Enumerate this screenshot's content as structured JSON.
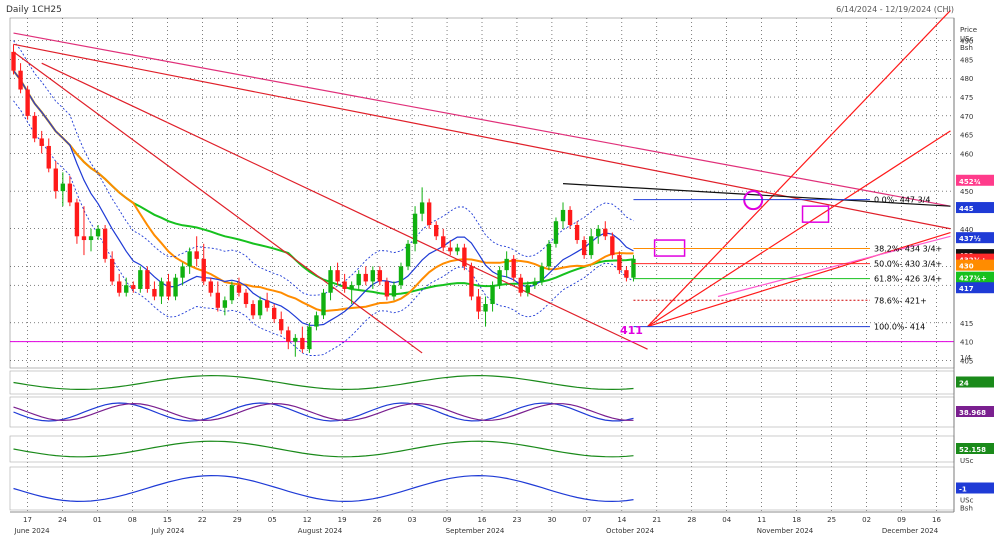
{
  "header": {
    "title": "Daily 1CH25",
    "date_range": "6/14/2024 - 12/19/2024 (CHI)"
  },
  "price_axis": {
    "label_lines": [
      "Price",
      "USc",
      "Bsh"
    ],
    "ticks": [
      "490",
      "485",
      "480",
      "475",
      "470",
      "465",
      "460",
      "450",
      "440",
      "430",
      "425",
      "415",
      "410",
      "405"
    ],
    "extra_label": "1/4",
    "badges": [
      {
        "text": "452¾",
        "value": 452.75,
        "color": "#ff3b8b",
        "text_color": "#ffffff"
      },
      {
        "text": "445",
        "value": 445.5,
        "color": "#1f3bd6",
        "text_color": "#ffffff"
      },
      {
        "text": "437½",
        "value": 437.5,
        "color": "#1f3bd6",
        "text_color": "#ffffff"
      },
      {
        "text": "433",
        "value": 433.0,
        "color": "#111111",
        "text_color": "#ffffff"
      },
      {
        "text": "432¾+",
        "value": 431.8,
        "color": "#ff2a2a",
        "text_color": "#ffffff"
      },
      {
        "text": "430",
        "value": 430.2,
        "color": "#ff8c00",
        "text_color": "#ffffff"
      },
      {
        "text": "427¾+",
        "value": 427.0,
        "color": "#16c11e",
        "text_color": "#ffffff"
      },
      {
        "text": "417",
        "value": 424.2,
        "color": "#1f3bd6",
        "text_color": "#ffffff"
      }
    ]
  },
  "fib_labels": [
    {
      "text": "0.0%- 447 3/4",
      "value": 447.75,
      "color": "#1f3bd6"
    },
    {
      "text": "38.2%- 434 3/4+",
      "value": 434.75,
      "color": "#ff8c00"
    },
    {
      "text": "50.0%- 430 3/4+",
      "value": 430.75,
      "color": "#ff2a2a"
    },
    {
      "text": "61.8%- 426 3/4+",
      "value": 426.75,
      "color": "#16c11e"
    },
    {
      "text": "78.6%- 421+",
      "value": 421.0,
      "color": "#d00000"
    },
    {
      "text": "100.0%- 414",
      "value": 414.0,
      "color": "#1f3bd6"
    }
  ],
  "annotation_low": {
    "text": "411",
    "color": "#e000e0"
  },
  "indicator_panels": [
    {
      "name": "momentum",
      "value_badge": "24",
      "badge_color": "#1a8a1a",
      "units": []
    },
    {
      "name": "stochastic",
      "value_badge": "38.968",
      "badge_color": "#7a1f8f",
      "units": []
    },
    {
      "name": "rsi",
      "value_badge": "52.158",
      "badge_color": "#1a8a1a",
      "units": [
        "USc"
      ]
    },
    {
      "name": "macd",
      "value_badge": "-1",
      "badge_color": "#1f3bd6",
      "units": [
        "USc",
        "Bsh"
      ]
    }
  ],
  "x_axis": {
    "day_ticks": [
      "17",
      "24",
      "01",
      "08",
      "15",
      "22",
      "29",
      "05",
      "12",
      "19",
      "26",
      "03",
      "09",
      "16",
      "23",
      "30",
      "07",
      "14",
      "21",
      "28",
      "04",
      "11",
      "18",
      "25",
      "02",
      "09",
      "16"
    ],
    "months": [
      "June 2024",
      "July 2024",
      "August 2024",
      "September 2024",
      "October 2024",
      "November 2024",
      "December 2024"
    ]
  },
  "colors": {
    "up_candle": "#10b010",
    "down_candle": "#ff1a1a",
    "background": "#ffffff",
    "grid": "#000000"
  },
  "chart_data": {
    "type": "candlestick",
    "title": "Daily 1CH25",
    "subtitle": "6/14/2024 - 12/19/2024 (CHI)",
    "y_units": "USc/Bsh",
    "ylim": [
      403,
      496
    ],
    "grid": true,
    "ohlc": [
      {
        "o": 487,
        "h": 489,
        "l": 481,
        "c": 482
      },
      {
        "o": 482,
        "h": 484,
        "l": 476,
        "c": 477
      },
      {
        "o": 477,
        "h": 478,
        "l": 469,
        "c": 470
      },
      {
        "o": 470,
        "h": 471,
        "l": 463,
        "c": 464
      },
      {
        "o": 464,
        "h": 466,
        "l": 460,
        "c": 462
      },
      {
        "o": 462,
        "h": 464,
        "l": 455,
        "c": 456
      },
      {
        "o": 456,
        "h": 458,
        "l": 448,
        "c": 450
      },
      {
        "o": 450,
        "h": 455,
        "l": 446,
        "c": 452
      },
      {
        "o": 452,
        "h": 454,
        "l": 446,
        "c": 447
      },
      {
        "o": 447,
        "h": 448,
        "l": 436,
        "c": 438
      },
      {
        "o": 438,
        "h": 446,
        "l": 433,
        "c": 437
      },
      {
        "o": 437,
        "h": 440,
        "l": 434,
        "c": 438
      },
      {
        "o": 438,
        "h": 441,
        "l": 437,
        "c": 440
      },
      {
        "o": 440,
        "h": 441,
        "l": 431,
        "c": 432
      },
      {
        "o": 432,
        "h": 434,
        "l": 425,
        "c": 426
      },
      {
        "o": 426,
        "h": 428,
        "l": 422,
        "c": 423
      },
      {
        "o": 423,
        "h": 427,
        "l": 422,
        "c": 425
      },
      {
        "o": 425,
        "h": 426,
        "l": 423,
        "c": 424
      },
      {
        "o": 424,
        "h": 430,
        "l": 423,
        "c": 429
      },
      {
        "o": 429,
        "h": 430,
        "l": 423,
        "c": 424
      },
      {
        "o": 424,
        "h": 426,
        "l": 421,
        "c": 422
      },
      {
        "o": 422,
        "h": 427,
        "l": 420,
        "c": 426
      },
      {
        "o": 426,
        "h": 428,
        "l": 421,
        "c": 422
      },
      {
        "o": 422,
        "h": 428,
        "l": 421,
        "c": 427
      },
      {
        "o": 427,
        "h": 431,
        "l": 425,
        "c": 430
      },
      {
        "o": 430,
        "h": 435,
        "l": 428,
        "c": 434
      },
      {
        "o": 434,
        "h": 438,
        "l": 430,
        "c": 432
      },
      {
        "o": 432,
        "h": 436,
        "l": 425,
        "c": 426
      },
      {
        "o": 426,
        "h": 427,
        "l": 422,
        "c": 423
      },
      {
        "o": 423,
        "h": 426,
        "l": 418,
        "c": 419
      },
      {
        "o": 419,
        "h": 422,
        "l": 417,
        "c": 421
      },
      {
        "o": 421,
        "h": 426,
        "l": 420,
        "c": 425
      },
      {
        "o": 425,
        "h": 427,
        "l": 422,
        "c": 423
      },
      {
        "o": 423,
        "h": 424,
        "l": 419,
        "c": 420
      },
      {
        "o": 420,
        "h": 421,
        "l": 416,
        "c": 417
      },
      {
        "o": 417,
        "h": 422,
        "l": 416,
        "c": 421
      },
      {
        "o": 421,
        "h": 423,
        "l": 418,
        "c": 419
      },
      {
        "o": 419,
        "h": 420,
        "l": 415,
        "c": 416
      },
      {
        "o": 416,
        "h": 418,
        "l": 412,
        "c": 413
      },
      {
        "o": 413,
        "h": 414,
        "l": 408,
        "c": 410
      },
      {
        "o": 410,
        "h": 412,
        "l": 406,
        "c": 411
      },
      {
        "o": 411,
        "h": 414,
        "l": 407,
        "c": 408
      },
      {
        "o": 408,
        "h": 415,
        "l": 407,
        "c": 414
      },
      {
        "o": 414,
        "h": 418,
        "l": 413,
        "c": 417
      },
      {
        "o": 417,
        "h": 424,
        "l": 416,
        "c": 423
      },
      {
        "o": 423,
        "h": 430,
        "l": 421,
        "c": 429
      },
      {
        "o": 429,
        "h": 431,
        "l": 425,
        "c": 426
      },
      {
        "o": 426,
        "h": 428,
        "l": 423,
        "c": 424
      },
      {
        "o": 424,
        "h": 426,
        "l": 420,
        "c": 425
      },
      {
        "o": 425,
        "h": 429,
        "l": 424,
        "c": 428
      },
      {
        "o": 428,
        "h": 430,
        "l": 425,
        "c": 426
      },
      {
        "o": 426,
        "h": 430,
        "l": 424,
        "c": 429
      },
      {
        "o": 429,
        "h": 430,
        "l": 425,
        "c": 426
      },
      {
        "o": 426,
        "h": 427,
        "l": 421,
        "c": 422
      },
      {
        "o": 422,
        "h": 426,
        "l": 421,
        "c": 425
      },
      {
        "o": 425,
        "h": 431,
        "l": 424,
        "c": 430
      },
      {
        "o": 430,
        "h": 437,
        "l": 429,
        "c": 436
      },
      {
        "o": 436,
        "h": 446,
        "l": 434,
        "c": 444
      },
      {
        "o": 444,
        "h": 451,
        "l": 442,
        "c": 447
      },
      {
        "o": 447,
        "h": 448,
        "l": 440,
        "c": 441
      },
      {
        "o": 441,
        "h": 442,
        "l": 437,
        "c": 438
      },
      {
        "o": 438,
        "h": 440,
        "l": 434,
        "c": 435
      },
      {
        "o": 435,
        "h": 437,
        "l": 433,
        "c": 434
      },
      {
        "o": 434,
        "h": 436,
        "l": 433,
        "c": 435
      },
      {
        "o": 435,
        "h": 436,
        "l": 429,
        "c": 430
      },
      {
        "o": 430,
        "h": 431,
        "l": 421,
        "c": 422
      },
      {
        "o": 422,
        "h": 424,
        "l": 416,
        "c": 418
      },
      {
        "o": 418,
        "h": 422,
        "l": 414,
        "c": 420
      },
      {
        "o": 420,
        "h": 426,
        "l": 418,
        "c": 425
      },
      {
        "o": 425,
        "h": 430,
        "l": 424,
        "c": 429
      },
      {
        "o": 429,
        "h": 434,
        "l": 427,
        "c": 432
      },
      {
        "o": 432,
        "h": 433,
        "l": 426,
        "c": 427
      },
      {
        "o": 427,
        "h": 428,
        "l": 422,
        "c": 423
      },
      {
        "o": 423,
        "h": 426,
        "l": 422,
        "c": 425
      },
      {
        "o": 425,
        "h": 427,
        "l": 424,
        "c": 426
      },
      {
        "o": 426,
        "h": 431,
        "l": 425,
        "c": 430
      },
      {
        "o": 430,
        "h": 437,
        "l": 429,
        "c": 436
      },
      {
        "o": 436,
        "h": 443,
        "l": 435,
        "c": 442
      },
      {
        "o": 442,
        "h": 447,
        "l": 440,
        "c": 445
      },
      {
        "o": 445,
        "h": 446,
        "l": 440,
        "c": 441
      },
      {
        "o": 441,
        "h": 442,
        "l": 436,
        "c": 437
      },
      {
        "o": 437,
        "h": 438,
        "l": 432,
        "c": 433
      },
      {
        "o": 433,
        "h": 440,
        "l": 432,
        "c": 438
      },
      {
        "o": 438,
        "h": 441,
        "l": 436,
        "c": 440
      },
      {
        "o": 440,
        "h": 442,
        "l": 437,
        "c": 438
      },
      {
        "o": 438,
        "h": 439,
        "l": 432,
        "c": 433
      },
      {
        "o": 433,
        "h": 434,
        "l": 428,
        "c": 429
      },
      {
        "o": 429,
        "h": 430,
        "l": 426,
        "c": 427
      },
      {
        "o": 427,
        "h": 433,
        "l": 426,
        "c": 432
      }
    ]
  }
}
